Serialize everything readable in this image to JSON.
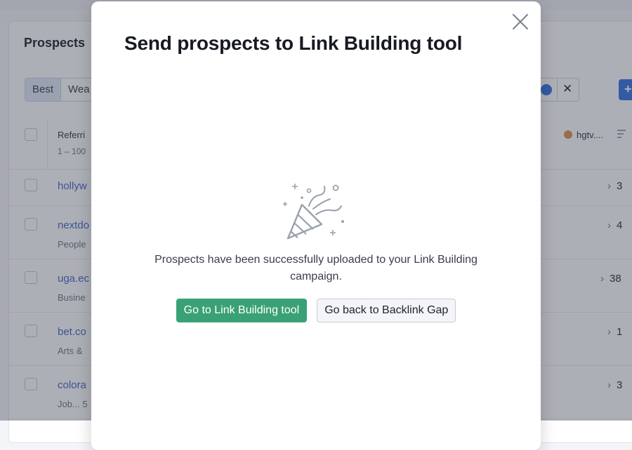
{
  "background": {
    "panel_title": "Prospects",
    "segments": [
      "Best",
      "Wea"
    ],
    "filter_clear_icon": "close-icon",
    "add_button_icon": "plus-icon",
    "table": {
      "header_label": "Referri",
      "header_sub": "1 – 100",
      "right_header": "hgtv....",
      "rows": [
        {
          "link": "hollyw",
          "sub": "",
          "right": "3"
        },
        {
          "link": "nextdo",
          "sub": "People",
          "right": "4"
        },
        {
          "link": "uga.ec",
          "sub": "Busine",
          "right": "38"
        },
        {
          "link": "bet.co",
          "sub": "Arts &",
          "right": "1"
        },
        {
          "link": "colora",
          "sub": "Job... 5",
          "right": "3"
        }
      ]
    }
  },
  "modal": {
    "title": "Send prospects to Link Building tool",
    "close_icon": "close-icon",
    "illustration_icon": "party-popper-icon",
    "message_line1": "Prospects have been successfully uploaded to your Link Building",
    "message_line2": "campaign.",
    "primary_button": "Go to Link Building tool",
    "secondary_button": "Go back to Backlink Gap",
    "colors": {
      "primary": "#3aa176",
      "accent_blue": "#2d6fe0",
      "link": "#3d62c8"
    }
  }
}
